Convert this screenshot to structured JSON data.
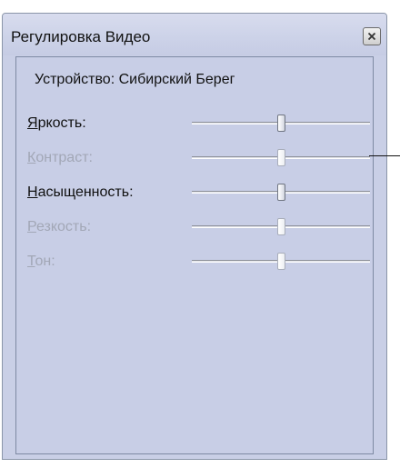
{
  "window": {
    "title": "Регулировка Видео",
    "close_icon": "close-icon"
  },
  "device": {
    "label": "Устройство: Сибирский Берег"
  },
  "sliders": [
    {
      "mnemonic": "Я",
      "rest": "ркость:",
      "enabled": true,
      "level": 0.5
    },
    {
      "mnemonic": "К",
      "rest": "онтраст:",
      "enabled": false,
      "level": 0.5
    },
    {
      "mnemonic": "Н",
      "rest": "асыщенность:",
      "enabled": true,
      "level": 0.5
    },
    {
      "mnemonic": "Р",
      "rest": "езкость:",
      "enabled": false,
      "level": 0.5
    },
    {
      "mnemonic": "Т",
      "rest": "он:",
      "enabled": false,
      "level": 0.5
    }
  ]
}
